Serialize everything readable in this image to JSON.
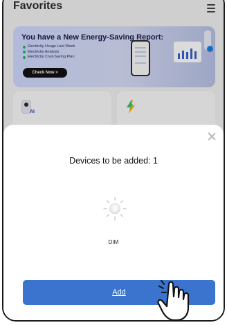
{
  "header": {
    "title": "Favorites",
    "menu_icon": "hamburger-menu-icon"
  },
  "banner": {
    "title": "You have a New Energy-Saving Report:",
    "items": [
      "Electricity Usage Last Week",
      "Electricity Analysis",
      "Electricity Cost-Saving Plan"
    ],
    "cta": "Check Now >",
    "bullet_color": "#1db955"
  },
  "cards": [
    {
      "icon": "ai-camera-icon",
      "tag": "AI"
    },
    {
      "icon": "lightning-bolt-icon"
    }
  ],
  "sheet": {
    "title": "Devices to be added: 1",
    "device": {
      "name": "DIM",
      "icon": "light-bulb-icon"
    },
    "add_label": "Add",
    "close_icon": "close-icon"
  },
  "colors": {
    "accent": "#3a74cf",
    "overlay": "rgba(0,0,0,0.14)"
  },
  "pointer": "tap-hand-icon"
}
